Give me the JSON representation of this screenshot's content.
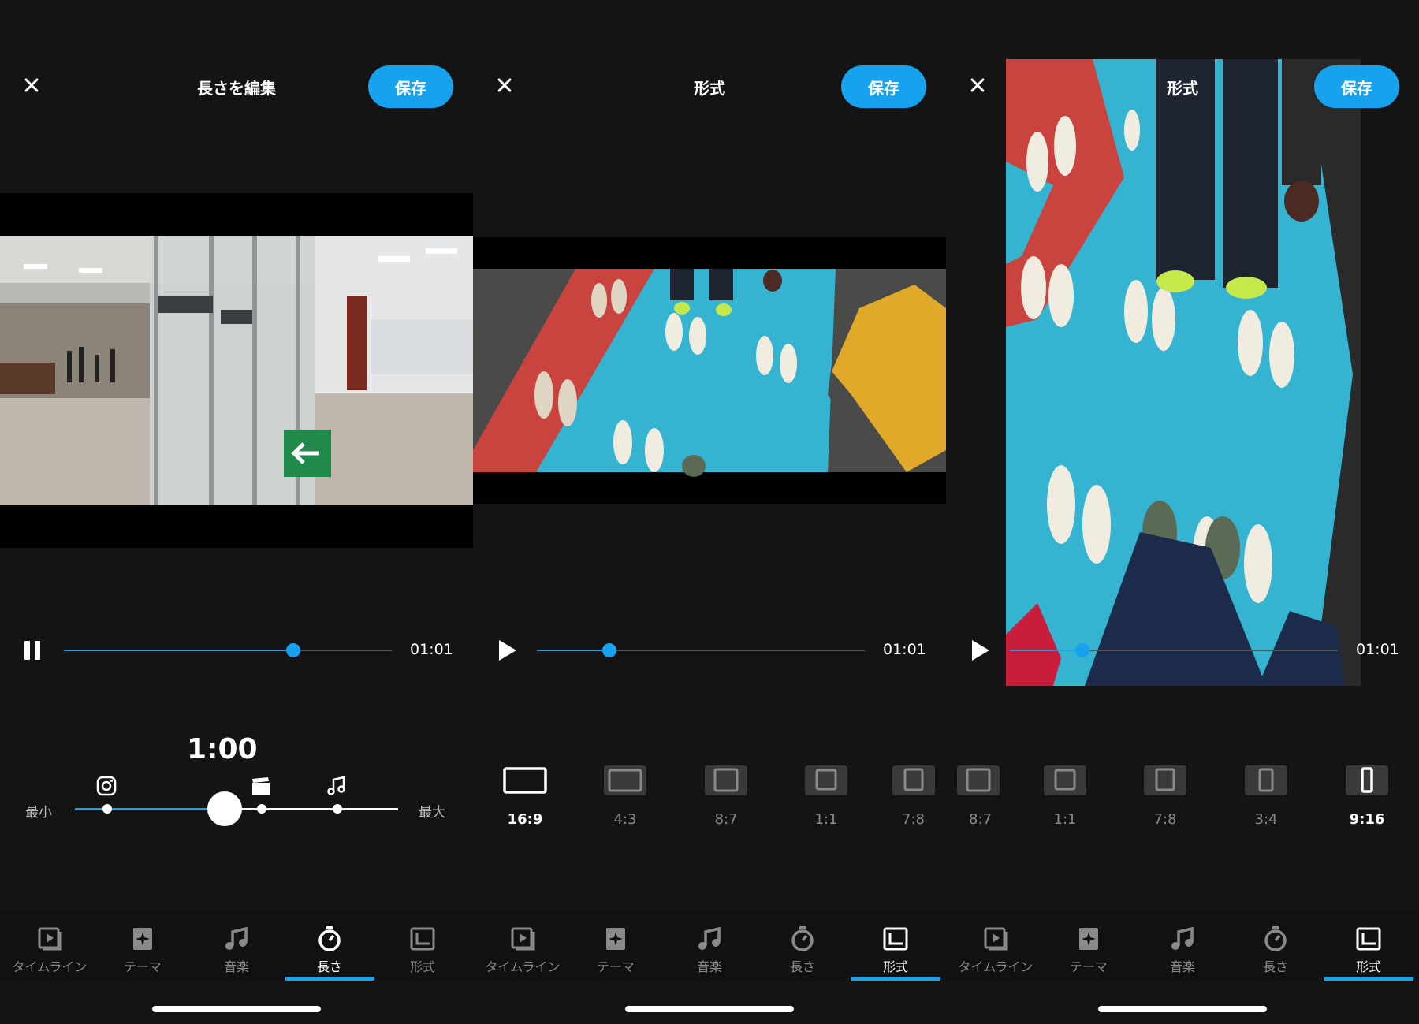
{
  "colors": {
    "accent": "#17a2ef",
    "background": "#141414",
    "inactive": "#8a8a8a"
  },
  "save_label": "保存",
  "tabs": [
    "タイムライン",
    "テーマ",
    "音楽",
    "長さ",
    "形式"
  ],
  "screen1": {
    "title": "長さを編集",
    "player": {
      "state": "playing",
      "progress": 0.7,
      "duration": "01:01"
    },
    "length": {
      "value": "1:00",
      "min_label": "最小",
      "max_label": "最大",
      "slider_position": 0.46,
      "marker_icons": [
        "instagram-icon",
        "clapperboard-icon",
        "music-note-icon"
      ]
    },
    "active_tab": 3
  },
  "screen2": {
    "title": "形式",
    "player": {
      "state": "paused",
      "progress": 0.22,
      "duration": "01:01"
    },
    "formats": [
      "16:9",
      "4:3",
      "8:7",
      "1:1",
      "7:8"
    ],
    "selected_format": "16:9",
    "active_tab": 4
  },
  "screen3": {
    "title": "形式",
    "player": {
      "state": "paused",
      "progress": 0.22,
      "duration": "01:01"
    },
    "formats": [
      "8:7",
      "1:1",
      "7:8",
      "3:4",
      "9:16"
    ],
    "selected_format": "9:16",
    "active_tab": 4
  }
}
